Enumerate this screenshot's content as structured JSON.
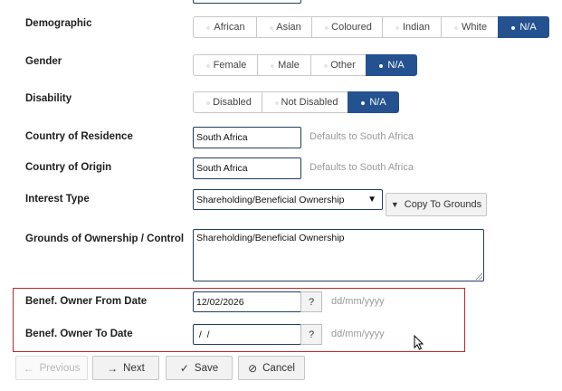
{
  "fields": {
    "demographic": {
      "label": "Demographic",
      "options": [
        "African",
        "Asian",
        "Coloured",
        "Indian",
        "White",
        "N/A"
      ],
      "selected": "N/A"
    },
    "gender": {
      "label": "Gender",
      "options": [
        "Female",
        "Male",
        "Other",
        "N/A"
      ],
      "selected": "N/A"
    },
    "disability": {
      "label": "Disability",
      "options": [
        "Disabled",
        "Not Disabled",
        "N/A"
      ],
      "selected": "N/A"
    },
    "country_residence": {
      "label": "Country of Residence",
      "value": "South Africa",
      "hint": "Defaults to South Africa"
    },
    "country_origin": {
      "label": "Country of Origin",
      "value": "South Africa",
      "hint": "Defaults to South Africa"
    },
    "interest_type": {
      "label": "Interest Type",
      "value": "Shareholding/Beneficial Ownership",
      "copy_label": "Copy To Grounds"
    },
    "grounds": {
      "label": "Grounds of Ownership / Control",
      "value": "Shareholding/Beneficial Ownership"
    },
    "from_date": {
      "label": "Benef. Owner From Date",
      "value": "12/02/2026",
      "help": "?",
      "hint": "dd/mm/yyyy"
    },
    "to_date": {
      "label": "Benef. Owner To Date",
      "value": " /  /",
      "help": "?",
      "hint": "dd/mm/yyyy"
    }
  },
  "buttons": {
    "previous": "Previous",
    "next": "Next",
    "save": "Save",
    "cancel": "Cancel"
  },
  "colors": {
    "selected": "#24518f",
    "highlight_border": "#c1272d"
  }
}
